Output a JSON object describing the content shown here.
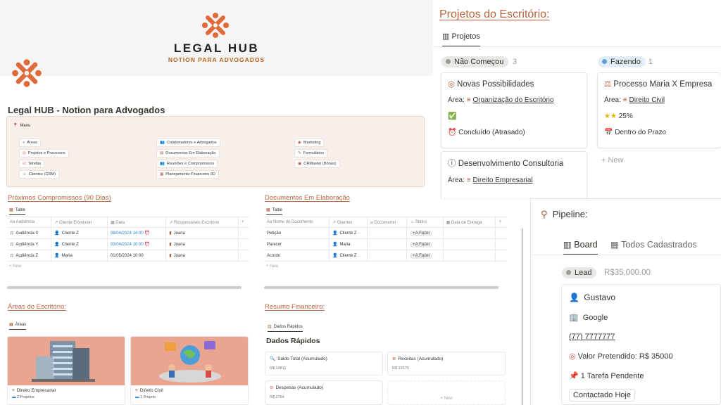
{
  "banner": {
    "brand": "LEGAL HUB",
    "brand_sub": "NOTION PARA ADVOGADOS"
  },
  "hub_title": "Legal HUB - Notion para Advogados",
  "menu": {
    "label": "Menu",
    "col1": [
      "Áreas",
      "Projetos e Processos",
      "Tarefas",
      "Clientes (CRM)"
    ],
    "col2": [
      "Colaboradores e Advogados",
      "Documentos Em Elaboração",
      "Reuniões e Compromissos",
      "Planejamento Financeiro 3D"
    ],
    "col3": [
      "Marketing",
      "Formulários",
      "CRMaster (Bônus)"
    ]
  },
  "compromissos": {
    "title": "Próximos Compromissos (90 Dias)",
    "view": "Table",
    "headers": [
      "Aa Audiência",
      "↗ Cliente Envolvido",
      "▦ Data",
      "↗ Responsáveis Escritório",
      "+"
    ],
    "rows": [
      [
        "Audiência X",
        "Cliente Z",
        "08/04/2024 14:00",
        "Joana"
      ],
      [
        "Audiência Y",
        "Cliente Z",
        "03/04/2024 10:00",
        "Joana"
      ],
      [
        "Audiência Z",
        "Maria",
        "01/05/2024 10:00",
        "Joana"
      ]
    ],
    "new": "+ New"
  },
  "documentos": {
    "title": "Documentos Em Elaboração",
    "view": "Table",
    "headers": [
      "Aa Nome do Documento",
      "↗ Clientes",
      "⌀ Documento",
      "☼ Status",
      "▦ Data de Entrega",
      "+"
    ],
    "rows": [
      [
        "Petição",
        "Cliente Z",
        "A Fazer"
      ],
      [
        "Parecer",
        "Maria",
        "A Fazer"
      ],
      [
        "Acordo",
        "Cliente Z",
        "A Fazer"
      ]
    ],
    "new": "+ New"
  },
  "areas": {
    "title": "Áreas do Escritório:",
    "view": "Áreas",
    "cards": [
      {
        "name": "Direito Empresarial",
        "sub": "2 Projetos"
      },
      {
        "name": "Direito Civil",
        "sub": "1 Projeto"
      }
    ]
  },
  "resumo": {
    "title": "Resumo Financeiro:",
    "view": "Dados Rápidos",
    "heading": "Dados Rápidos",
    "cards": [
      {
        "label": "Saldo Total (Acumulado)",
        "value": "R$ 13811"
      },
      {
        "label": "Receitas (Acumulado)",
        "value": "R$ 16575"
      },
      {
        "label": "Despesas (Acumulado)",
        "value": "R$ 2764"
      }
    ],
    "new": "+ New"
  },
  "projetos": {
    "title": "Projetos do Escritório:",
    "view": "Projetos",
    "groups": [
      {
        "status": "Não Começou",
        "count": "3",
        "dot": "#9b9a97"
      },
      {
        "status": "Fazendo",
        "count": "1",
        "dot": "#5e9fd6"
      }
    ],
    "card1": {
      "title": "Novas Possibilidades",
      "area_label": "Área:",
      "area": "Organização do Escritório",
      "check": "✅",
      "status": "Concluído (Atrasado)"
    },
    "card2": {
      "title": "Desenvolvimento Consultoria",
      "area_label": "Área:",
      "area": "Direito Empresarial"
    },
    "card3": {
      "title": "Processo Maria X Empresa",
      "area_label": "Área:",
      "area": "Direito Civil",
      "progress": "25%",
      "deadline": "Dentro do Prazo"
    },
    "new": "+ New"
  },
  "pipeline": {
    "title": "Pipeline:",
    "tab_board": "Board",
    "tab_all": "Todos Cadastrados",
    "lead": "Lead",
    "lead_value": "R$35,000.00",
    "card": {
      "name": "Gustavo",
      "company": "Google",
      "phone": "(77) 7777777",
      "value": "Valor Pretendido: R$ 35000",
      "task": "1 Tarefa Pendente",
      "tag": "Contactado Hoje"
    }
  },
  "colors": {
    "accent": "#b8633c",
    "brand_orange": "#e06a3a",
    "menu_bg": "#f8eeea"
  }
}
